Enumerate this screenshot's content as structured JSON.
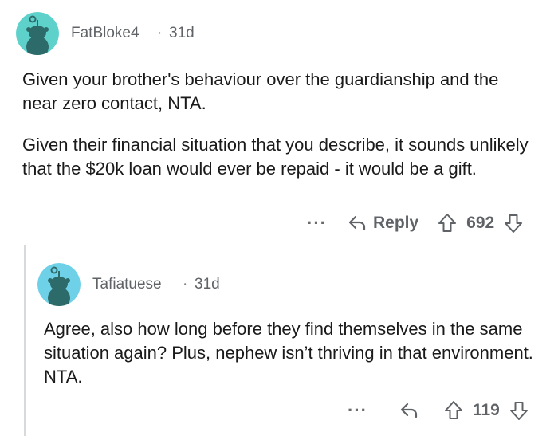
{
  "comment1": {
    "username": "FatBloke4",
    "separator": "·",
    "time": "31d",
    "paragraphs": [
      "Given your brother's behaviour over the guardianship and the near zero contact, NTA.",
      "Given their financial situation that you describe, it sounds unlikely that the $20k loan would ever be repaid - it would be a gift."
    ],
    "more_label": "···",
    "reply_label": "Reply",
    "score": "692",
    "avatar_color": "#5ed1cb"
  },
  "comment2": {
    "username": "Tafiatuese",
    "separator": "·",
    "time": "31d",
    "paragraphs": [
      "Agree, also how long before they find themselves in the same situation again? Plus, nephew isn’t thriving in that environment. NTA."
    ],
    "more_label": "···",
    "score": "119",
    "avatar_color": "#6fd1e8"
  },
  "icons": {
    "reply": "reply-arrow-icon",
    "upvote": "upvote-arrow-icon",
    "downvote": "downvote-arrow-icon",
    "more": "more-dots-icon",
    "avatar": "snoo-avatar-icon"
  }
}
